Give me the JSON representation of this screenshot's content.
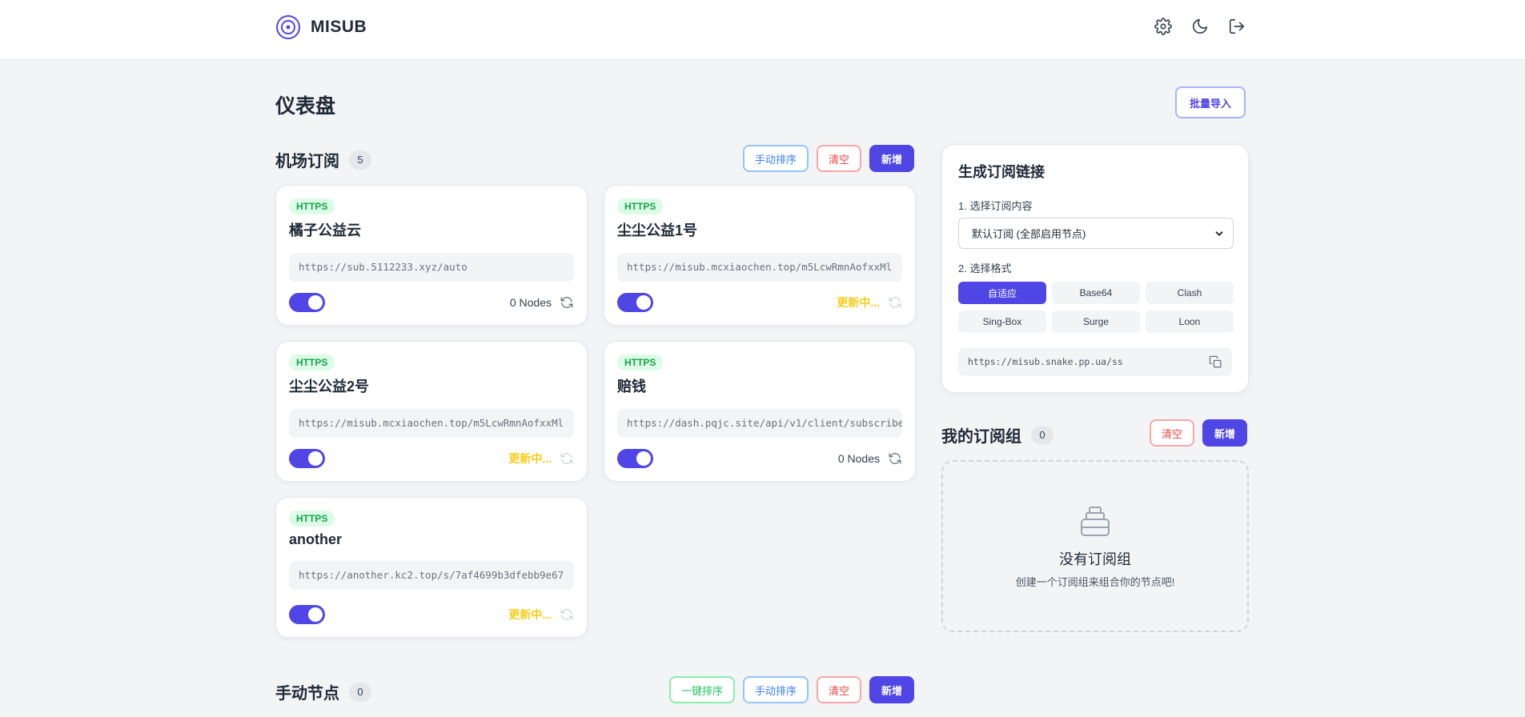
{
  "app": {
    "name": "MISUB"
  },
  "header": {
    "icons": [
      "settings-icon",
      "moon-icon",
      "logout-icon"
    ]
  },
  "page": {
    "title": "仪表盘",
    "bulk_import_label": "批量导入"
  },
  "subscriptions": {
    "title": "机场订阅",
    "count": "5",
    "actions": {
      "sort": "手动排序",
      "clear": "清空",
      "add": "新增"
    },
    "items": [
      {
        "protocol": "HTTPS",
        "name": "橘子公益云",
        "url": "https://sub.5112233.xyz/auto",
        "enabled": true,
        "status": "0 Nodes",
        "status_type": "nodes"
      },
      {
        "protocol": "HTTPS",
        "name": "尘尘公益1号",
        "url": "https://misub.mcxiaochen.top/m5LcwRmnAofxxMl",
        "enabled": true,
        "status": "更新中...",
        "status_type": "updating"
      },
      {
        "protocol": "HTTPS",
        "name": "尘尘公益2号",
        "url": "https://misub.mcxiaochen.top/m5LcwRmnAofxxMl",
        "enabled": true,
        "status": "更新中...",
        "status_type": "updating"
      },
      {
        "protocol": "HTTPS",
        "name": "赔钱",
        "url": "https://dash.pqjc.site/api/v1/client/subscribe",
        "enabled": true,
        "status": "0 Nodes",
        "status_type": "nodes"
      },
      {
        "protocol": "HTTPS",
        "name": "another",
        "url": "https://another.kc2.top/s/7af4699b3dfebb9e67",
        "enabled": true,
        "status": "更新中...",
        "status_type": "updating"
      }
    ]
  },
  "generator": {
    "title": "生成订阅链接",
    "step1_label": "1. 选择订阅内容",
    "selected_content": "默认订阅 (全部启用节点)",
    "step2_label": "2. 选择格式",
    "formats": [
      "自适应",
      "Base64",
      "Clash",
      "Sing-Box",
      "Surge",
      "Loon"
    ],
    "active_format": "自适应",
    "link": "https://misub.snake.pp.ua/ss"
  },
  "groups": {
    "title": "我的订阅组",
    "count": "0",
    "actions": {
      "clear": "清空",
      "add": "新增"
    },
    "empty_title": "没有订阅组",
    "empty_subtitle": "创建一个订阅组来组合你的节点吧!"
  },
  "manual_nodes": {
    "title": "手动节点",
    "count": "0",
    "actions": {
      "auto_sort": "一键排序",
      "sort": "手动排序",
      "clear": "清空",
      "add": "新增"
    }
  },
  "colors": {
    "accent": "#4f46e5",
    "danger": "#ef4444",
    "success": "#16a34a",
    "warning": "#facc15",
    "background": "#f3f4f6"
  }
}
